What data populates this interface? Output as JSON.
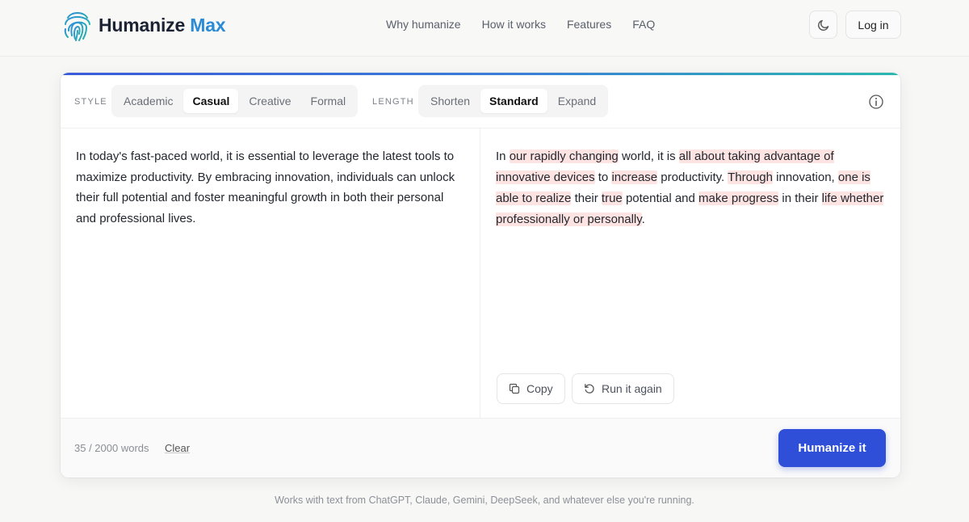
{
  "header": {
    "brand_primary": "Humanize",
    "brand_accent": "Max",
    "nav": [
      "Why humanize",
      "How it works",
      "Features",
      "FAQ"
    ],
    "theme_icon": "moon-icon",
    "login_label": "Log in"
  },
  "toolbar": {
    "style_label": "STYLE",
    "style_options": [
      "Academic",
      "Casual",
      "Creative",
      "Formal"
    ],
    "style_selected": "Casual",
    "length_label": "LENGTH",
    "length_options": [
      "Shorten",
      "Standard",
      "Expand"
    ],
    "length_selected": "Standard",
    "info_icon": "info-icon"
  },
  "input": {
    "text": "In today's fast-paced world, it is essential to leverage the latest tools to maximize productivity. By embracing innovation, individuals can unlock their full potential and foster meaningful growth in both their personal and professional lives."
  },
  "output": {
    "segments": [
      {
        "t": "In ",
        "h": false
      },
      {
        "t": "our rapidly changing",
        "h": true
      },
      {
        "t": " world, it is ",
        "h": false
      },
      {
        "t": "all about taking advantage of innovative devices",
        "h": true
      },
      {
        "t": " to ",
        "h": false
      },
      {
        "t": "increase",
        "h": true
      },
      {
        "t": " productivity. ",
        "h": false
      },
      {
        "t": "Through",
        "h": true
      },
      {
        "t": " innovation, ",
        "h": false
      },
      {
        "t": "one is able to realize",
        "h": true
      },
      {
        "t": " their ",
        "h": false
      },
      {
        "t": "true",
        "h": true
      },
      {
        "t": " potential and ",
        "h": false
      },
      {
        "t": "make progress",
        "h": true
      },
      {
        "t": " in their ",
        "h": false
      },
      {
        "t": "life whether professionally or personally",
        "h": true
      },
      {
        "t": ".",
        "h": false
      }
    ],
    "copy_label": "Copy",
    "run_again_label": "Run it again"
  },
  "footer": {
    "word_count": "35 / 2000 words",
    "clear_label": "Clear",
    "humanize_label": "Humanize it"
  },
  "tagline": "Works with text from ChatGPT, Claude, Gemini, DeepSeek, and whatever else you're running.",
  "colors": {
    "accent": "#2f4fd8",
    "highlight": "#fde4e2",
    "brand_accent": "#2b8bd6"
  }
}
